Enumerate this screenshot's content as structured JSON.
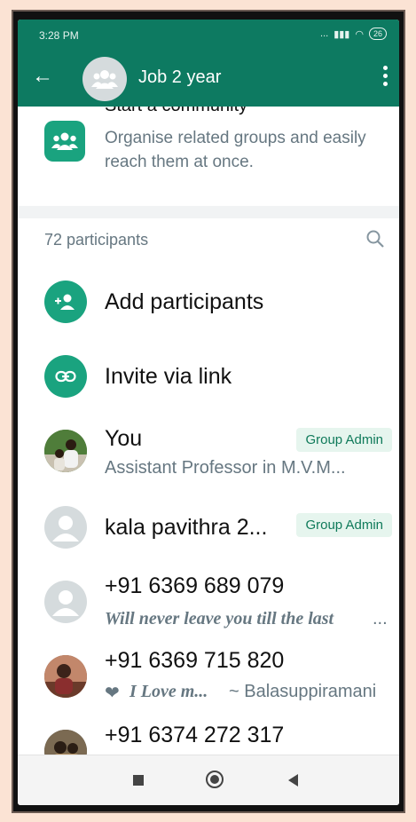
{
  "status": {
    "time": "3:28 PM",
    "signal": "...",
    "battery": "26"
  },
  "header": {
    "title": "Job 2 year"
  },
  "community": {
    "clipped_title": "Start a community",
    "description": "Organise related groups and easily reach them at once."
  },
  "participants": {
    "count_label": "72 participants"
  },
  "actions": {
    "add": "Add participants",
    "invite": "Invite via link"
  },
  "members": [
    {
      "name": "You",
      "about": "Assistant Professor in M.V.M...",
      "badge": "Group Admin"
    },
    {
      "name": "kala pavithra 2...",
      "badge": "Group Admin"
    },
    {
      "name": "+91 6369 689 079",
      "about": "Will never leave you till the last",
      "ellipsis": "..."
    },
    {
      "name": "+91 6369 715 820",
      "about_styled": "I Love m...",
      "about_plain": "~ Balasuppiramani"
    },
    {
      "name": "+91 6374 272 317"
    }
  ],
  "colors": {
    "primary": "#0d7a61",
    "accent": "#1aa37f",
    "badge_bg": "#e6f5ee"
  }
}
